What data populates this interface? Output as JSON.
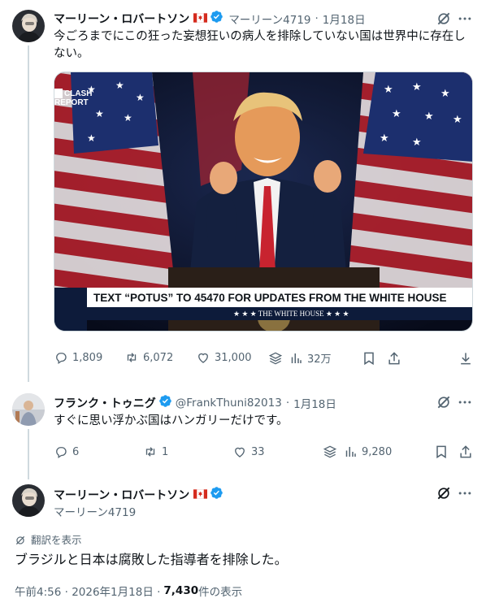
{
  "thread": {
    "tweet1": {
      "name": "マーリーン・ロバートソン",
      "handle": "マーリーン4719",
      "date": "1月18日",
      "text": "今ごろまでにこの狂った妄想狂いの病人を排除していない国は世界中に存在しない。",
      "media": {
        "logo_top": "CLASH",
        "logo_bottom": "REPORT",
        "banner_text": "TEXT “POTUS” TO 45470 FOR UPDATES FROM THE WHITE HOUSE",
        "banner_sub": "★ ★ ★   THE WHITE HOUSE   ★ ★ ★"
      },
      "stats": {
        "replies": "1,809",
        "reposts": "6,072",
        "likes": "31,000",
        "views": "32万"
      }
    },
    "tweet2": {
      "name": "フランク・トゥニグ",
      "handle": "@FrankThuni82013",
      "date": "1月18日",
      "text": "すぐに思い浮かぶ国はハンガリーだけです。",
      "stats": {
        "replies": "6",
        "reposts": "1",
        "likes": "33",
        "views": "9,280"
      }
    },
    "main": {
      "name": "マーリーン・ロバートソン",
      "handle": "マーリーン4719",
      "translate_label": "翻訳を表示",
      "text": "ブラジルと日本は腐敗した指導者を排除した。",
      "timestamp": "午前4:56 · 2026年1月18日 · ",
      "views_count": "7,430",
      "views_label": " 件の表示"
    },
    "separator": "·"
  },
  "colors": {
    "text": "#0f1419",
    "secondary": "#536471",
    "verified": "#1d9bf0",
    "line": "#cfd9de"
  }
}
